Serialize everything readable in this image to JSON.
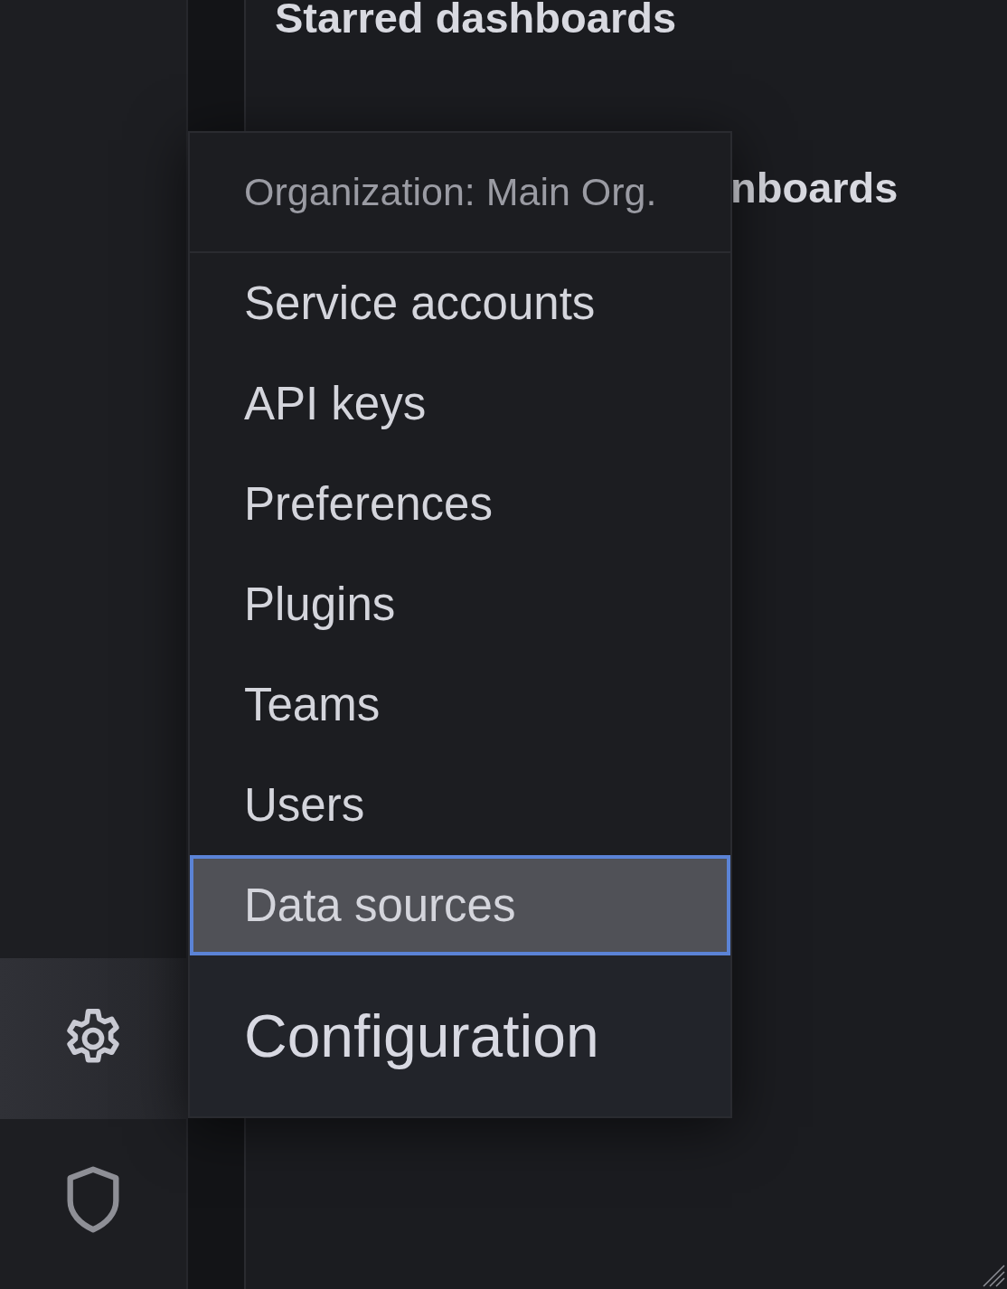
{
  "main": {
    "starred_heading": "Starred dashboards",
    "partial_heading": "nboards"
  },
  "menu": {
    "header": "Organization: Main Org.",
    "items": [
      {
        "label": "Service accounts",
        "selected": false
      },
      {
        "label": "API keys",
        "selected": false
      },
      {
        "label": "Preferences",
        "selected": false
      },
      {
        "label": "Plugins",
        "selected": false
      },
      {
        "label": "Teams",
        "selected": false
      },
      {
        "label": "Users",
        "selected": false
      },
      {
        "label": "Data sources",
        "selected": true
      }
    ],
    "title": "Configuration"
  },
  "sidebar": {
    "items": [
      {
        "kind": "gear",
        "selected": true
      },
      {
        "kind": "shield",
        "selected": false
      }
    ]
  }
}
